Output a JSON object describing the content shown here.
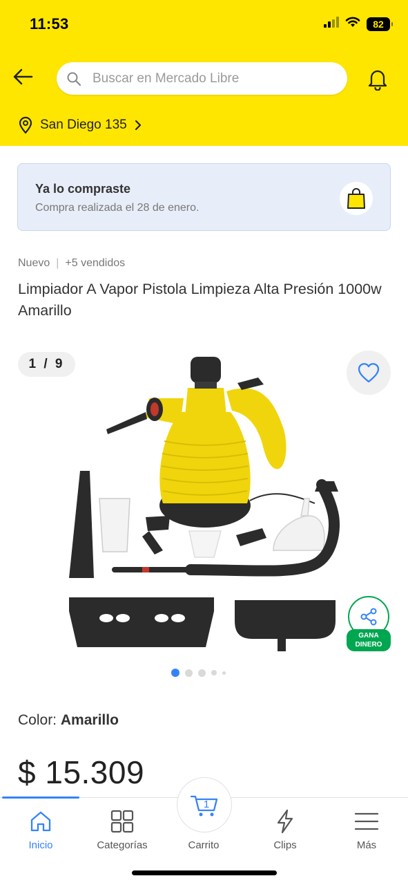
{
  "status_bar": {
    "time": "11:53",
    "battery": "82",
    "icons": [
      "signal-icon",
      "wifi-icon",
      "battery-icon"
    ]
  },
  "header": {
    "back_icon": "arrow-left-icon",
    "search_placeholder": "Buscar en Mercado Libre",
    "search_icon": "search-icon",
    "notifications_icon": "bell-icon",
    "location": "San Diego 135",
    "location_icon": "location-pin-icon",
    "brand_color": "#ffe600"
  },
  "purchase_banner": {
    "title": "Ya lo compraste",
    "subtitle": "Compra realizada el 28 de enero.",
    "icon": "shopping-bag-icon"
  },
  "product": {
    "condition": "Nuevo",
    "sold": "+5 vendidos",
    "title": "Limpiador A Vapor Pistola Limpieza Alta Presión 1000w Amarillo",
    "gallery": {
      "counter": "1 / 9",
      "current_index": 1,
      "total_images": 9,
      "favorite_icon": "heart-icon",
      "share_icon": "share-icon",
      "share_label": "GANA DINERO",
      "image": "yellow-steam-cleaner-with-accessories"
    },
    "color_label": "Color:",
    "color_value": "Amarillo",
    "price": "$ 15.309"
  },
  "bottom_nav": {
    "items": [
      {
        "label": "Inicio",
        "icon": "home-icon",
        "active": true
      },
      {
        "label": "Categorías",
        "icon": "grid-icon",
        "active": false
      },
      {
        "label": "Carrito",
        "icon": "cart-icon",
        "active": false,
        "badge": "1"
      },
      {
        "label": "Clips",
        "icon": "lightning-icon",
        "active": false
      },
      {
        "label": "Más",
        "icon": "menu-icon",
        "active": false
      }
    ]
  },
  "colors": {
    "accent": "#3483fa",
    "success": "#00a650",
    "banner_bg": "#e8eef9"
  }
}
